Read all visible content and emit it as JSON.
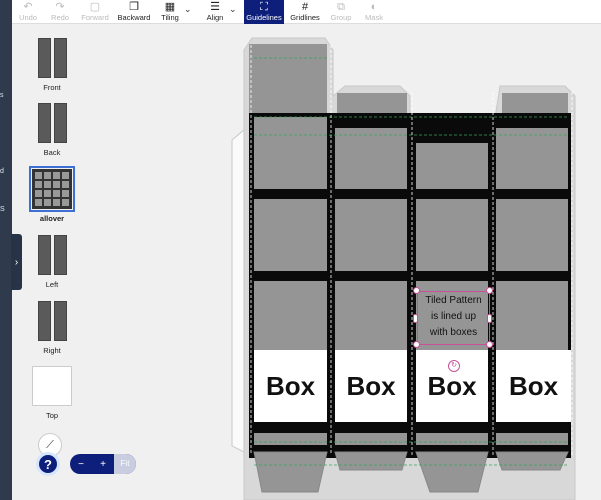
{
  "toolbar": {
    "undo": "Undo",
    "redo": "Redo",
    "forward": "Forward",
    "backward": "Backward",
    "tiling": "Tiling",
    "align": "Align",
    "guidelines": "Guidelines",
    "gridlines": "Gridlines",
    "group": "Group",
    "mask": "Mask"
  },
  "left_strip": {
    "labels": [
      "s",
      "d",
      "S"
    ]
  },
  "views": [
    {
      "label": "Front"
    },
    {
      "label": "Back"
    },
    {
      "label": "allover",
      "selected": true
    },
    {
      "label": "Left"
    },
    {
      "label": "Right"
    },
    {
      "label": "Top"
    }
  ],
  "canvas": {
    "box_labels": [
      "Box",
      "Box",
      "Box",
      "Box"
    ],
    "selected_text": [
      "Tiled Pattern",
      "is lined up",
      "with boxes"
    ]
  },
  "zoom": {
    "minus": "−",
    "plus": "+",
    "fit": "Fit"
  },
  "help": "?",
  "colors": {
    "accent": "#0d1f7a",
    "selection": "#c8509a",
    "panel_bg": "#959595"
  }
}
